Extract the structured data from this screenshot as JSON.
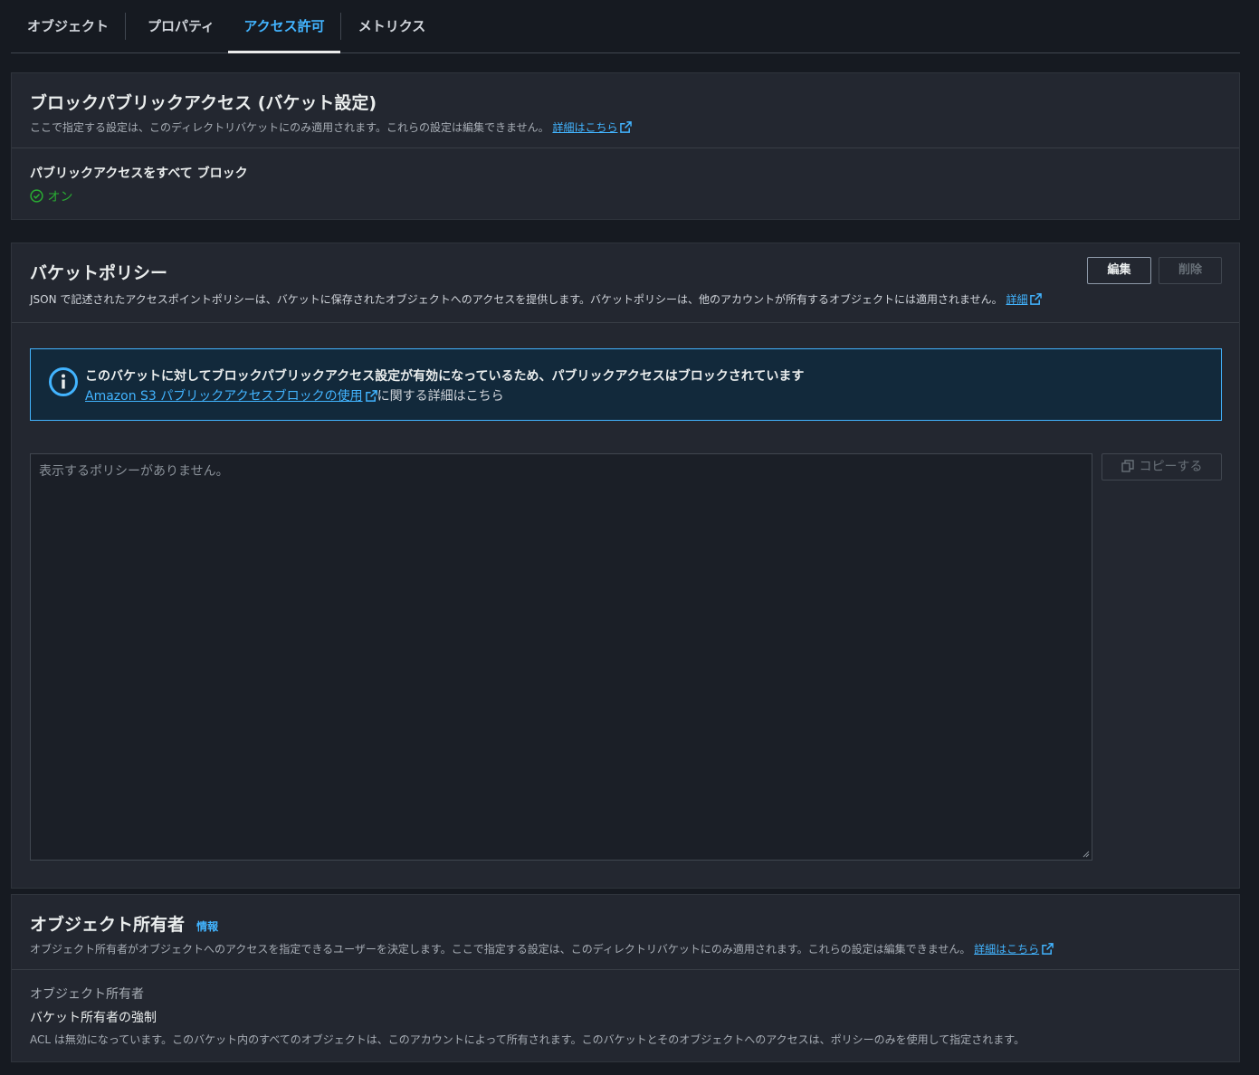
{
  "tabs": [
    "オブジェクト",
    "プロパティ",
    "アクセス許可",
    "メトリクス"
  ],
  "active_tab": "アクセス許可",
  "block_public_access": {
    "title": "ブロックパブリックアクセス (バケット設定)",
    "description": "ここで指定する設定は、このディレクトリバケットにのみ適用されます。これらの設定は編集できません。",
    "learn_more": "詳細はこちら",
    "setting_label": "パブリックアクセスをすべて ブロック",
    "setting_value": "オン",
    "status_color": "#29ad32"
  },
  "bucket_policy": {
    "title": "バケットポリシー",
    "description": "JSON で記述されたアクセスポイントポリシーは、バケットに保存されたオブジェクトへのアクセスを提供します。バケットポリシーは、他のアカウントが所有するオブジェクトには適用されません。",
    "learn_more": "詳細",
    "edit_button": "編集",
    "delete_button": "削除",
    "alert": {
      "title": "このバケットに対してブロックパブリックアクセス設定が有効になっているため、パブリックアクセスはブロックされています",
      "link": "Amazon S3 パブリックアクセスブロックの使用",
      "suffix": "に関する詳細はこちら"
    },
    "policy_placeholder": "表示するポリシーがありません。",
    "copy_button": "コピーする"
  },
  "object_ownership": {
    "title": "オブジェクト所有者",
    "info": "情報",
    "description": "オブジェクト所有者がオブジェクトへのアクセスを指定できるユーザーを決定します。ここで指定する設定は、このディレクトリバケットにのみ適用されます。これらの設定は編集できません。",
    "learn_more": "詳細はこちら",
    "field_label": "オブジェクト所有者",
    "field_value": "バケット所有者の強制",
    "field_note": "ACL は無効になっています。このバケット内のすべてのオブジェクトは、このアカウントによって所有されます。このバケットとそのオブジェクトへのアクセスは、ポリシーのみを使用して指定されます。"
  },
  "colors": {
    "accent": "#42b4ff",
    "background": "#161a21",
    "panel": "#232730"
  }
}
